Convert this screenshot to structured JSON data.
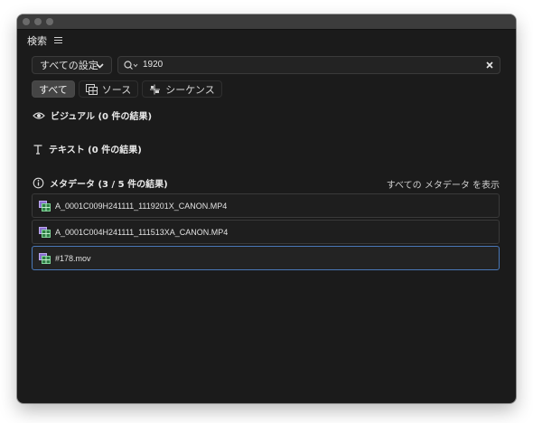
{
  "panel": {
    "title": "検索"
  },
  "search": {
    "scope": "すべての設定",
    "query": "1920"
  },
  "filters": [
    {
      "label": "すべて",
      "active": true
    },
    {
      "label": "ソース",
      "active": false
    },
    {
      "label": "シーケンス",
      "active": false
    }
  ],
  "sections": {
    "visual": "ビジュアル (0 件の結果)",
    "text": "テキスト (0 件の結果)",
    "metadata": "メタデータ (3 / 5 件の結果)",
    "show_all": "すべての メタデータ を表示"
  },
  "results": [
    {
      "name": "A_0001C009H241111_1119201X_CANON.MP4"
    },
    {
      "name": "A_0001C004H241111_111513XA_CANON.MP4"
    },
    {
      "name": "#178.mov"
    }
  ],
  "colors": {
    "panel_bg": "#1b1b1b",
    "selection_border": "#4a78b8",
    "clip_icon_green": "#4fb26a",
    "clip_icon_purple": "#8b6fd0"
  }
}
